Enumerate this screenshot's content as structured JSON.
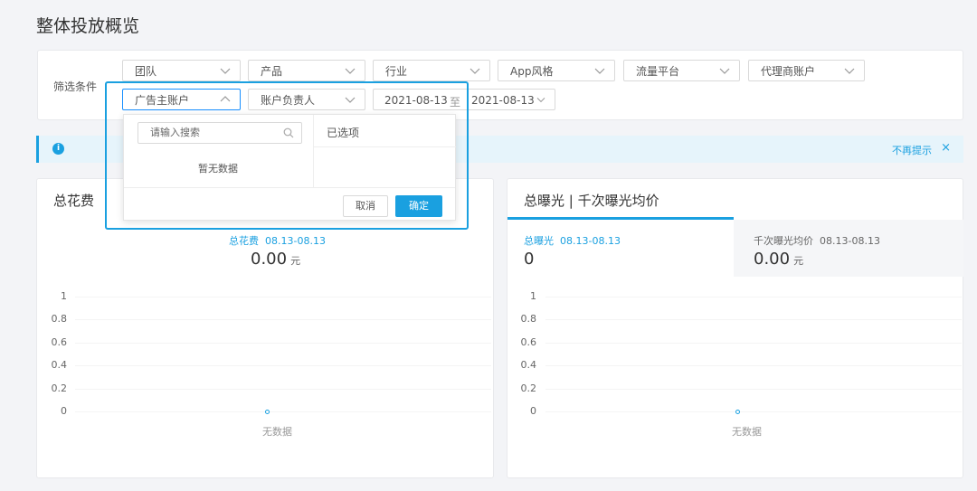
{
  "page": {
    "title": "整体投放概览"
  },
  "filters": {
    "label": "筛选条件",
    "row1": [
      {
        "label": "团队"
      },
      {
        "label": "产品"
      },
      {
        "label": "行业"
      },
      {
        "label": "App风格"
      },
      {
        "label": "流量平台"
      },
      {
        "label": "代理商账户"
      }
    ],
    "row2": [
      {
        "label": "广告主账户"
      },
      {
        "label": "账户负责人"
      }
    ],
    "date": {
      "start": "2021-08-13",
      "separator": "至",
      "end": "2021-08-13"
    }
  },
  "dropdown": {
    "search_placeholder": "请输入搜索",
    "no_data": "暂无数据",
    "selected_title": "已选项",
    "cancel_label": "取消",
    "ok_label": "确定"
  },
  "info_bar": {
    "dismiss_label": "不再提示",
    "close_symbol": "×",
    "icon": "info-icon"
  },
  "cards": [
    {
      "title": "总花费",
      "metrics": [
        {
          "label": "总花费",
          "range": "08.13-08.13",
          "value": "0.00",
          "unit": "元"
        }
      ],
      "empty_label": "无数据"
    },
    {
      "title": "总曝光 | 千次曝光均价",
      "metrics": [
        {
          "label": "总曝光",
          "range": "08.13-08.13",
          "value": "0",
          "unit": ""
        },
        {
          "label": "千次曝光均价",
          "range": "08.13-08.13",
          "value": "0.00",
          "unit": "元"
        }
      ],
      "empty_label": "无数据"
    }
  ],
  "chart_data": [
    {
      "type": "line",
      "y_ticks": [
        "1",
        "0.8",
        "0.6",
        "0.4",
        "0.2",
        "0"
      ],
      "ylim": [
        0,
        1
      ],
      "x": [],
      "values": []
    },
    {
      "type": "line",
      "y_ticks": [
        "1",
        "0.8",
        "0.6",
        "0.4",
        "0.2",
        "0"
      ],
      "ylim": [
        0,
        1
      ],
      "x": [],
      "values": []
    }
  ],
  "colors": {
    "accent": "#1aa0e0",
    "info_bg": "#e6f4fb",
    "page_bg": "#f3f4f7"
  }
}
